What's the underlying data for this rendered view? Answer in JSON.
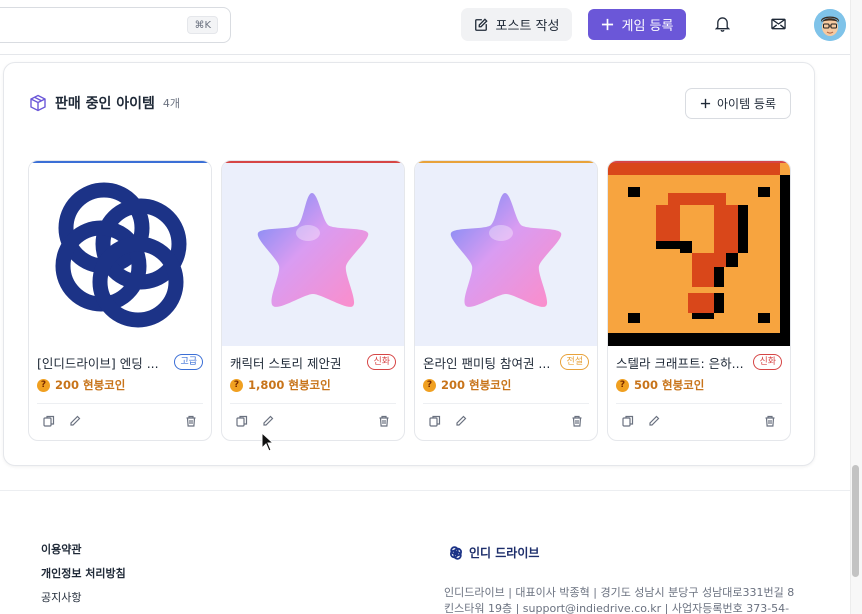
{
  "header": {
    "search_shortcut": "⌘K",
    "post_button": "포스트 작성",
    "register_game_button": "게임 등록"
  },
  "section": {
    "title": "판매 중인 아이템",
    "count": "4개",
    "add_item_button": "아이템 등록"
  },
  "items": [
    {
      "name": "[인디드라이브] 엔딩 ...",
      "grade": "고급",
      "price": "200 현붕코인",
      "accent": "#3b6fd6",
      "grade_color": "#3b6fd6"
    },
    {
      "name": "캐릭터 스토리 제안권",
      "grade": "신화",
      "price": "1,800 현붕코인",
      "accent": "#d64545",
      "grade_color": "#d64545"
    },
    {
      "name": "온라인 팬미팅 참여권 ...",
      "grade": "전설",
      "price": "200 현붕코인",
      "accent": "#e8a23a",
      "grade_color": "#e8a23a"
    },
    {
      "name": "스텔라 크래프트: 은하...",
      "grade": "신화",
      "price": "500 현붕코인",
      "accent": "#d64545",
      "grade_color": "#d64545"
    }
  ],
  "footer": {
    "links": [
      "이용약관",
      "개인정보 처리방침",
      "공지사항"
    ],
    "brand": "인디 드라이브",
    "info_line1": "인디드라이브 | 대표이사 박종혁 | 경기도 성남시 분당구 성남대로331번길 8",
    "info_line2": "킨스타워 19층 | support@indiedrive.co.kr | 사업자등록번호 373-54-"
  },
  "colors": {
    "primary": "#6b57d8",
    "coin": "#f0a021",
    "price_text": "#c8741a"
  }
}
